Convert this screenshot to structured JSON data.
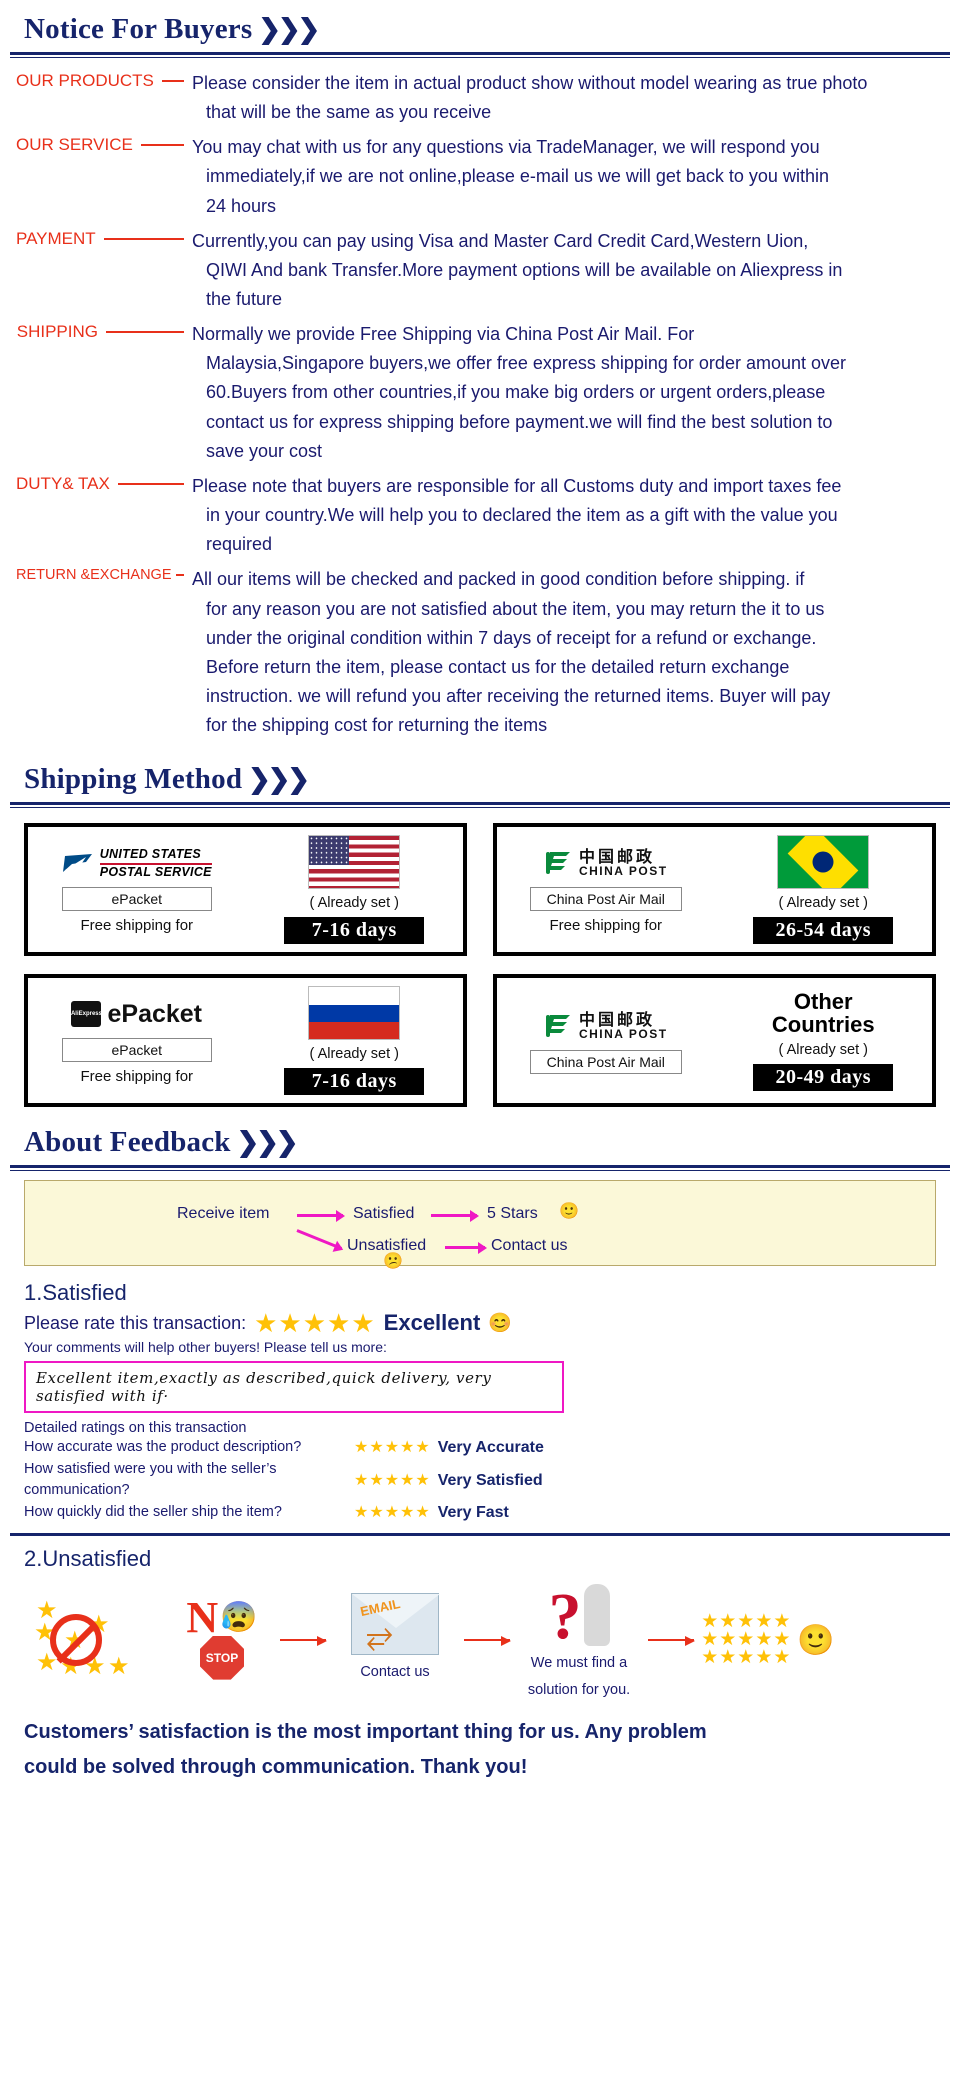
{
  "sections": {
    "notice_title": "Notice For Buyers",
    "shipping_title": "Shipping Method",
    "feedback_title": "About Feedback",
    "chevrons": "»›"
  },
  "notice": [
    {
      "label": "OUR PRODUCTS",
      "lines": [
        "Please consider the item in actual product show without model wearing as true photo",
        "that will be the same as you receive"
      ]
    },
    {
      "label": "OUR SERVICE",
      "lines": [
        "You may chat with us for any questions via TradeManager, we will respond you",
        "immediately,if we are not online,please e-mail us we will get back to you within",
        "24 hours"
      ]
    },
    {
      "label": "PAYMENT",
      "lines": [
        "Currently,you can pay using Visa and Master Card Credit Card,Western Uion,",
        "QIWI And bank Transfer.More payment options will be available on Aliexpress in",
        "the future"
      ]
    },
    {
      "label": "SHIPPING",
      "lines": [
        "Normally we provide Free Shipping via China Post Air Mail. For",
        "Malaysia,Singapore buyers,we offer free express shipping for order amount over",
        "60.Buyers from other countries,if you make big orders or urgent orders,please",
        "contact us for express shipping before payment.we will find the best solution to",
        "save your cost"
      ]
    },
    {
      "label": "DUTY& TAX",
      "lines": [
        "Please note that buyers are responsible for all Customs duty and import taxes fee",
        "in your country.We will help you to declared the item as a gift with the value you",
        "required"
      ]
    },
    {
      "label": "RETURN &EXCHANGE",
      "lines": [
        "All our items will be checked and packed in good condition before shipping. if",
        "for any reason you are not satisfied about the item, you may return the it to us",
        "under the original condition within 7 days of receipt for a refund or exchange.",
        "Before return the item, please contact us for the detailed return exchange",
        "instruction. we will refund you after receiving the returned items. Buyer will pay",
        "for the shipping cost for returning the items"
      ]
    }
  ],
  "shipping_boxes": [
    {
      "carrier_name": "UNITED STATES POSTAL SERVICE",
      "carrier_line1": "UNITED STATES",
      "carrier_line2": "POSTAL SERVICE",
      "service": "ePacket",
      "free_text": "Free shipping for",
      "flag": "united-states",
      "already_set": "( Already set )",
      "days": "7-16 days"
    },
    {
      "carrier_name": "CHINA POST",
      "carrier_cn": "中国邮政",
      "carrier_en": "CHINA POST",
      "service": "China Post Air Mail",
      "free_text": "Free shipping for",
      "flag": "brazil",
      "already_set": "( Already set )",
      "days": "26-54 days"
    },
    {
      "carrier_name": "AliExpress ePacket",
      "carrier_brand": "ePacket",
      "service": "ePacket",
      "free_text": "Free shipping for",
      "flag": "russia",
      "already_set": "( Already set )",
      "days": "7-16 days"
    },
    {
      "carrier_name": "CHINA POST",
      "carrier_cn": "中国邮政",
      "carrier_en": "CHINA POST",
      "service": "China Post Air Mail",
      "free_text": "",
      "flag": "other-countries",
      "other_line1": "Other",
      "other_line2": "Countries",
      "already_set": "( Already set )",
      "days": "20-49 days"
    }
  ],
  "feedback_flow": {
    "start": "Receive item",
    "branch_top": "Satisfied",
    "branch_bottom": "Unsatisfied",
    "result_top": "5 Stars",
    "result_bottom": "Contact us",
    "emoji_happy": "🙂",
    "emoji_sad": "😕"
  },
  "satisfied": {
    "heading": "1.Satisfied",
    "rate_label": "Please rate this transaction:",
    "stars": "★★★★★",
    "rating_word": "Excellent",
    "rating_emoji": "😊",
    "comments_prompt": "Your comments will help other buyers! Please tell us more:",
    "comment_text": "Excellent item,exactly as described,quick delivery, very satisfied with if·",
    "detailed_title": "Detailed ratings on this transaction",
    "ratings": [
      {
        "question": "How accurate was the product description?",
        "stars": "★★★★★",
        "value": "Very Accurate"
      },
      {
        "question": "How satisfied were you with the seller’s communication?",
        "stars": "★★★★★",
        "value": "Very Satisfied"
      },
      {
        "question": "How quickly did the seller ship the item?",
        "stars": "★★★★★",
        "value": "Very Fast"
      }
    ]
  },
  "unsatisfied": {
    "heading": "2.Unsatisfied",
    "no_text": "N",
    "stop_text": "STOP",
    "email_text": "EMAIL",
    "contact_caption": "Contact us",
    "solution_caption_line1": "We must find a",
    "solution_caption_line2": "solution for you.",
    "final_stars": "★★★★★",
    "final_emoji": "🙂"
  },
  "closing": {
    "line1": "Customers’ satisfaction is the most important thing for us. Any problem",
    "line2": "could be solved through communication. Thank you!"
  },
  "colors": {
    "navy": "#16246b",
    "red_label": "#e8301a",
    "magenta": "#ef18c4",
    "gold": "#ffc107",
    "cream": "#fbf8d8"
  }
}
